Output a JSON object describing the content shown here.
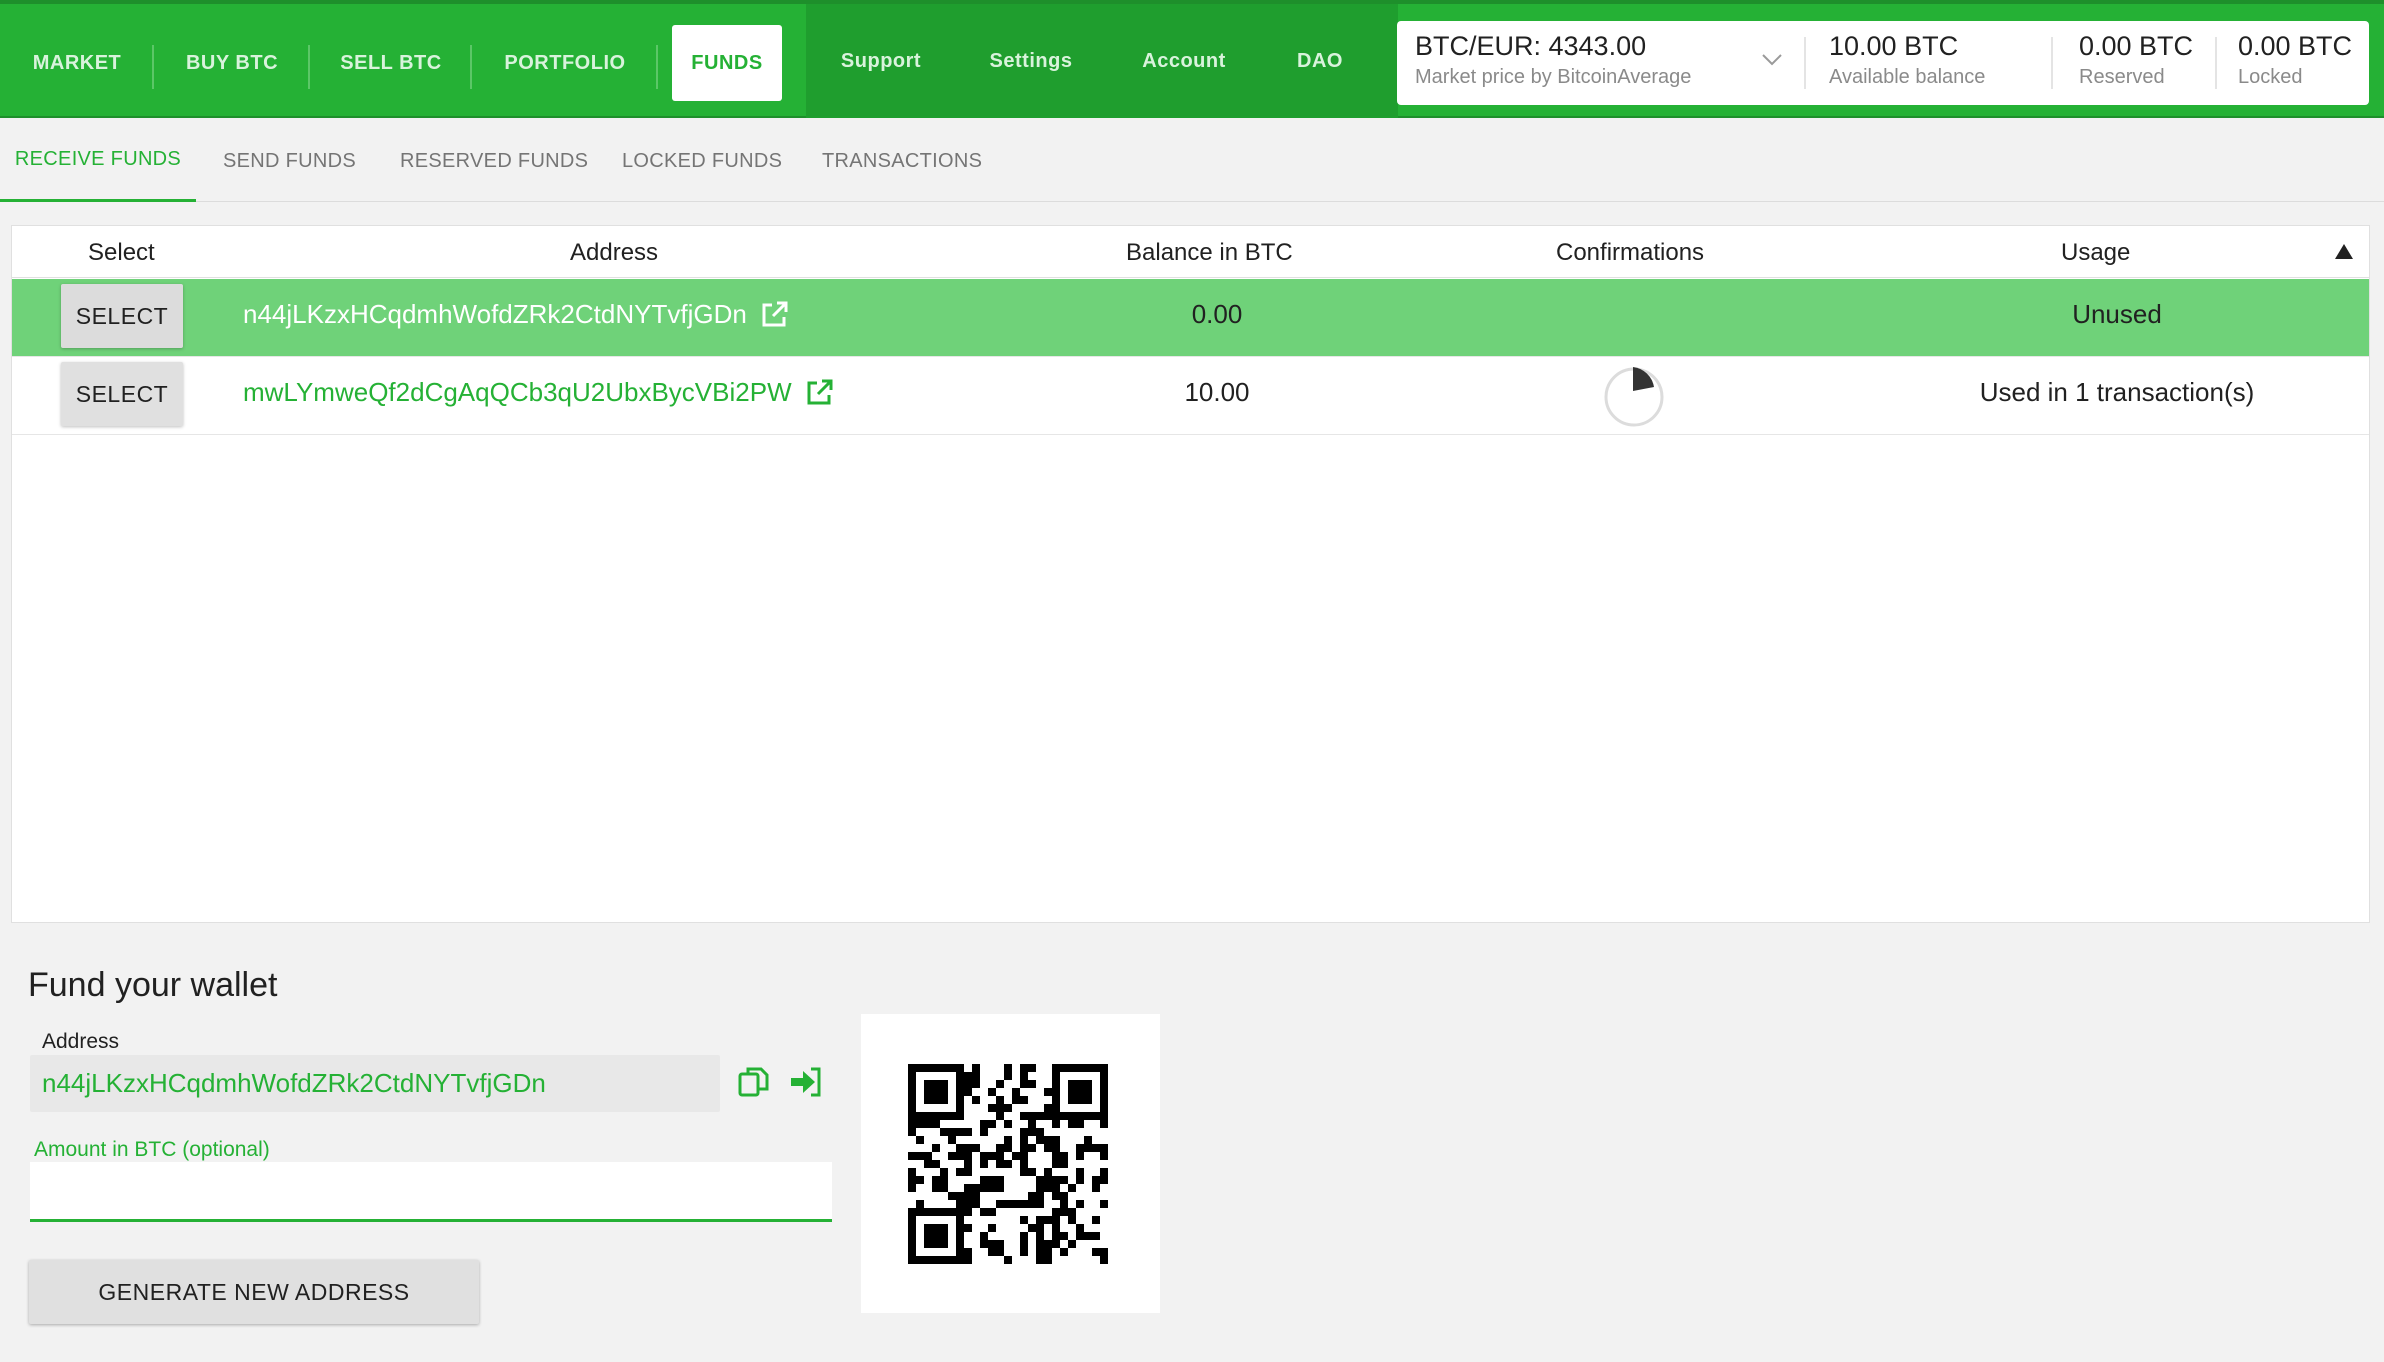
{
  "nav": {
    "main": [
      "MARKET",
      "BUY BTC",
      "SELL BTC",
      "PORTFOLIO",
      "FUNDS"
    ],
    "active": "FUNDS",
    "secondary": [
      "Support",
      "Settings",
      "Account",
      "DAO"
    ]
  },
  "market": {
    "price": "BTC/EUR: 4343.00",
    "price_sub": "Market price by BitcoinAverage",
    "available": "10.00 BTC",
    "available_sub": "Available balance",
    "reserved": "0.00 BTC",
    "reserved_sub": "Reserved",
    "locked": "0.00 BTC",
    "locked_sub": "Locked"
  },
  "subtabs": [
    "RECEIVE FUNDS",
    "SEND FUNDS",
    "RESERVED FUNDS",
    "LOCKED FUNDS",
    "TRANSACTIONS"
  ],
  "table": {
    "headers": [
      "Select",
      "Address",
      "Balance in BTC",
      "Confirmations",
      "Usage"
    ],
    "rows": [
      {
        "select": "SELECT",
        "address": "n44jLKzxHCqdmhWofdZRk2CtdNYTvfjGDn",
        "balance": "0.00",
        "confirmations": "",
        "usage": "Unused",
        "selected": true
      },
      {
        "select": "SELECT",
        "address": "mwLYmweQf2dCgAqQCb3qU2UbxBycVBi2PW",
        "balance": "10.00",
        "confirmations_progress": 0.1,
        "usage": "Used in 1 transaction(s)",
        "selected": false
      }
    ]
  },
  "fund": {
    "title": "Fund your wallet",
    "address_label": "Address",
    "address": "n44jLKzxHCqdmhWofdZRk2CtdNYTvfjGDn",
    "amount_label": "Amount in BTC (optional)",
    "amount_value": "",
    "generate_button": "GENERATE NEW ADDRESS"
  },
  "icons": [
    "chevron-down-icon",
    "external-link-icon",
    "confirmation-progress-icon",
    "copy-icon",
    "open-wallet-icon",
    "qr-code-icon"
  ],
  "colors": {
    "brand": "#25b135",
    "brand_dark": "#1f9e2e",
    "selected_row": "#6fd279"
  }
}
